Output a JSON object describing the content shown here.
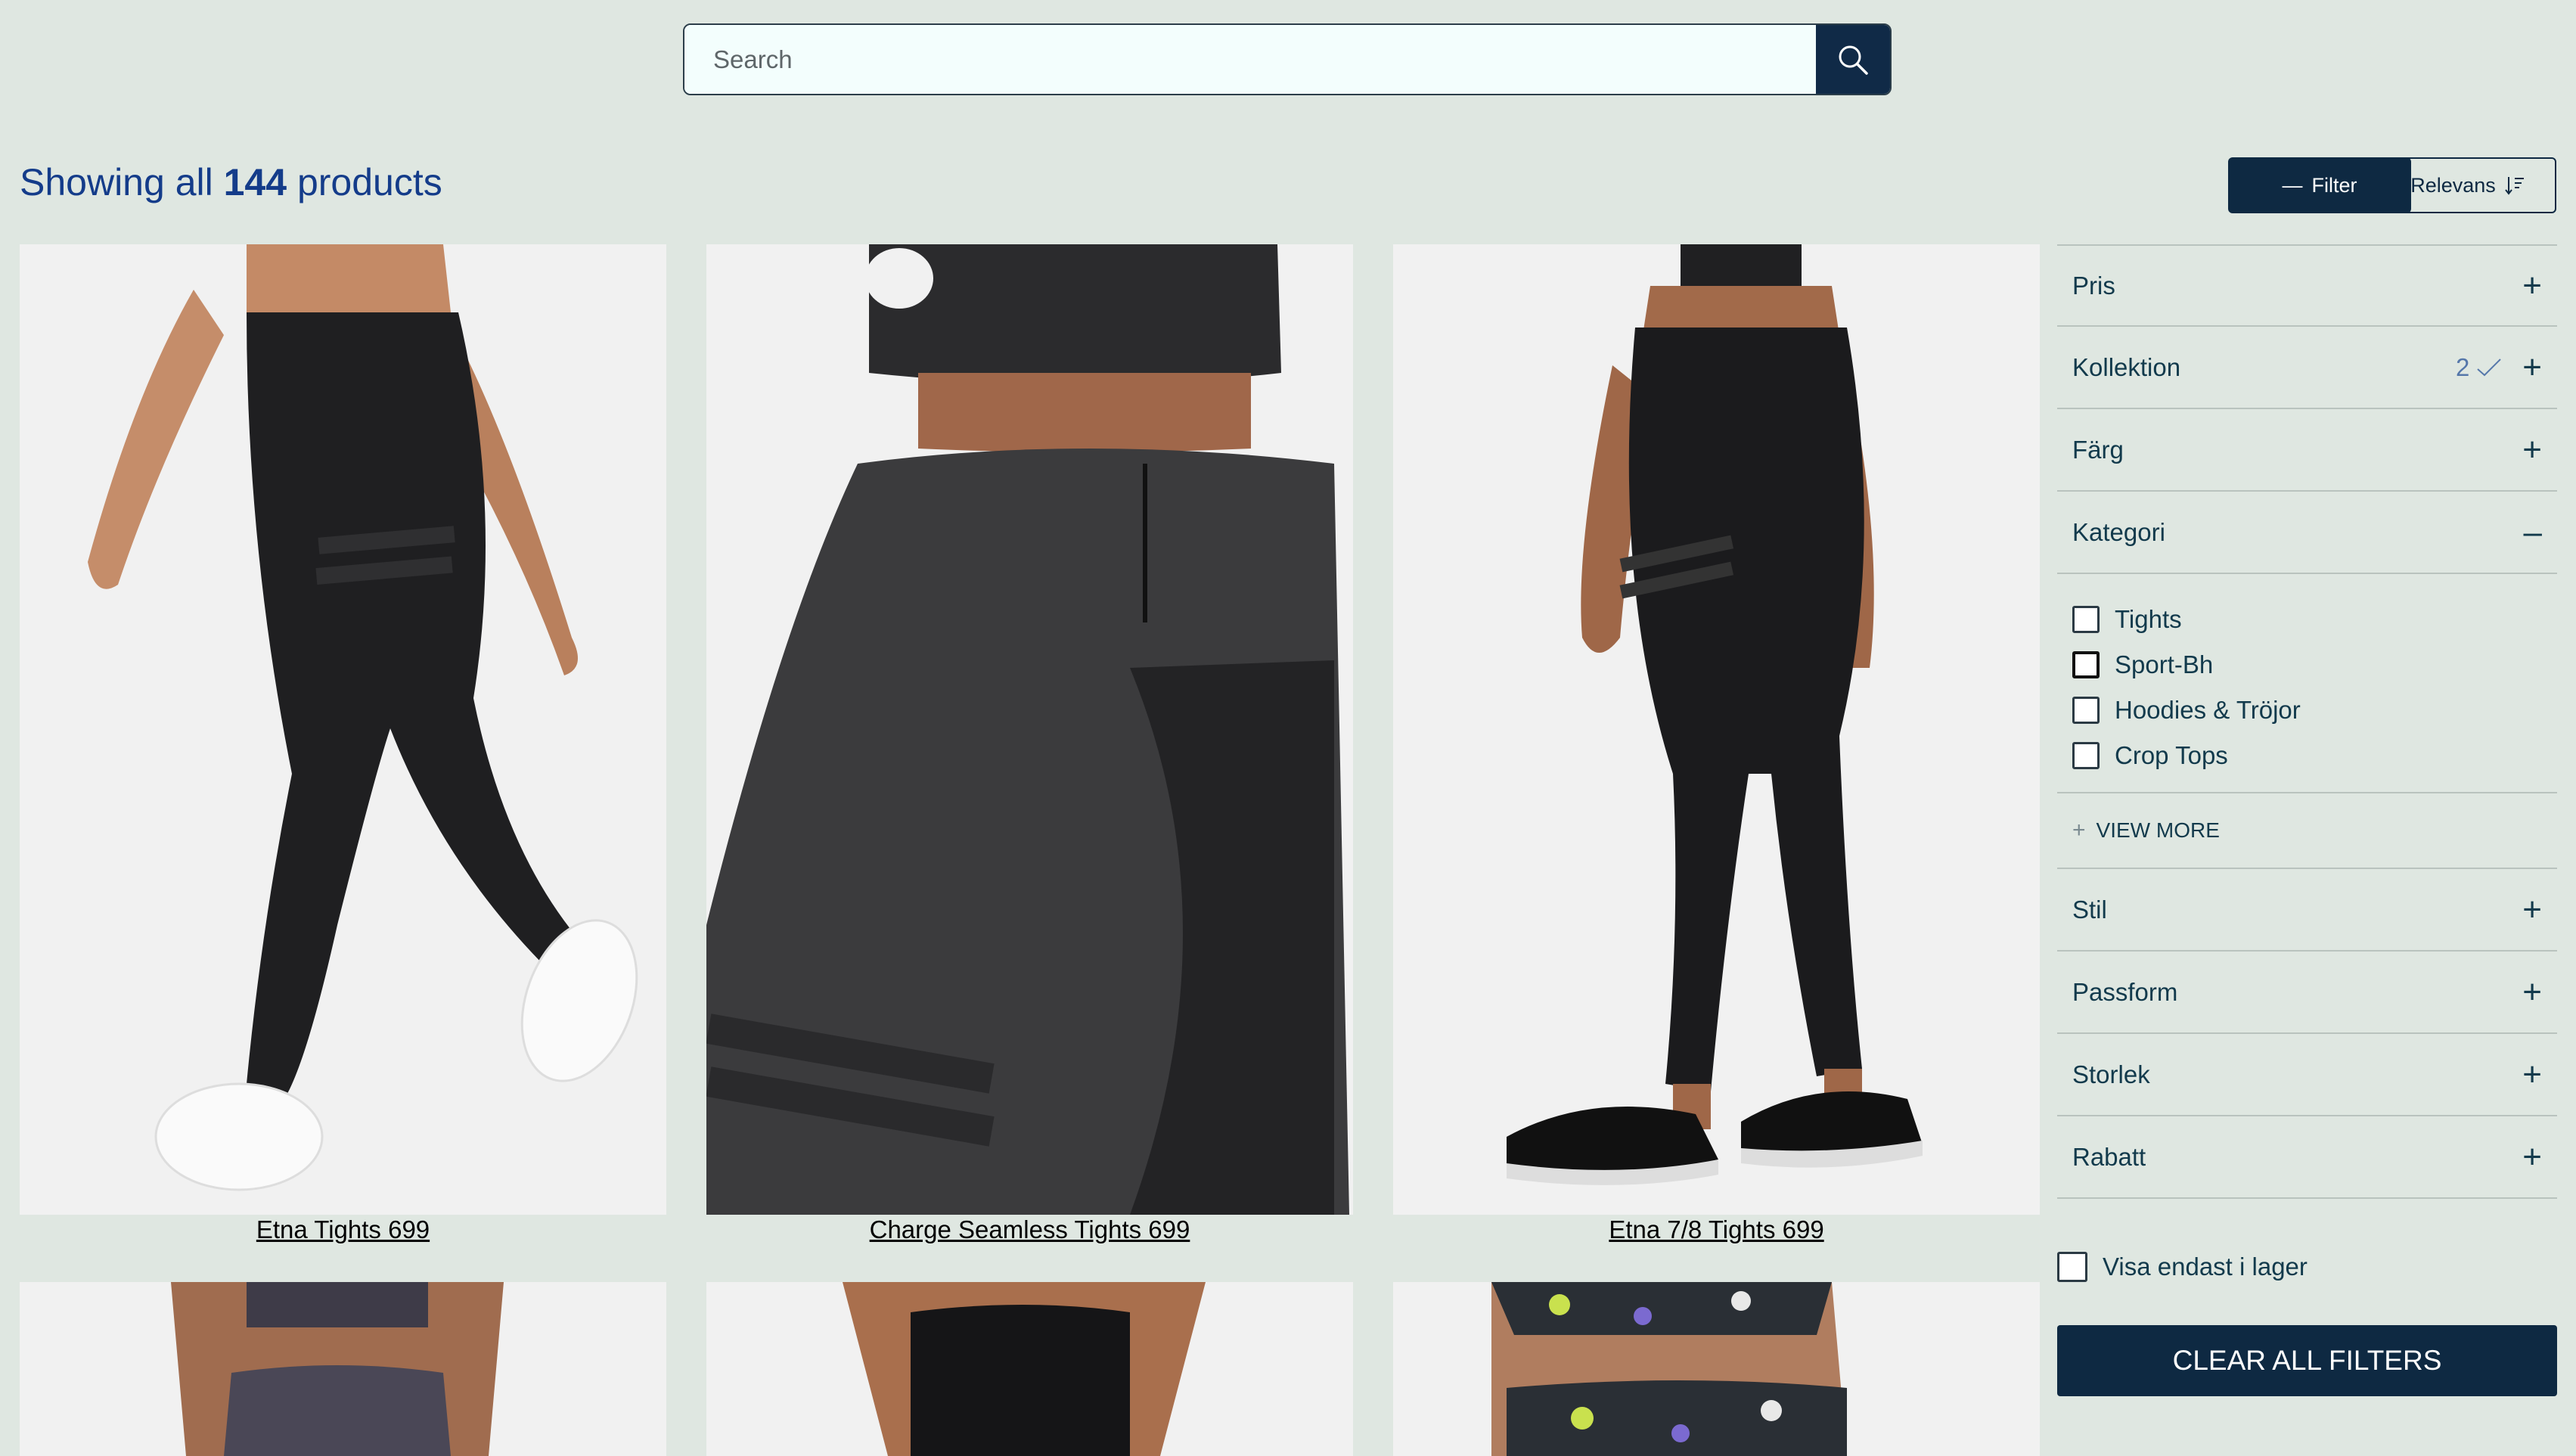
{
  "search": {
    "placeholder": "Search"
  },
  "heading": {
    "prefix": "Showing all",
    "count": "144",
    "suffix": "products"
  },
  "toolbar": {
    "filter_label": "Filter",
    "sort_label": "Relevans"
  },
  "products": [
    {
      "name": "Etna Tights 699"
    },
    {
      "name": "Charge Seamless Tights 699"
    },
    {
      "name": "Etna 7/8 Tights 699"
    }
  ],
  "filters": {
    "facets_top": [
      {
        "label": "Pris"
      },
      {
        "label": "Kollektion",
        "count": "2"
      },
      {
        "label": "Färg"
      },
      {
        "label": "Kategori"
      }
    ],
    "kategori_options": [
      "Tights",
      "Sport-Bh",
      "Hoodies & Tröjor",
      "Crop Tops"
    ],
    "view_more": "VIEW MORE",
    "facets_bottom": [
      {
        "label": "Stil"
      },
      {
        "label": "Passform"
      },
      {
        "label": "Storlek"
      },
      {
        "label": "Rabatt"
      }
    ],
    "stock_label": "Visa endast i lager",
    "clear_label": "CLEAR ALL FILTERS"
  }
}
